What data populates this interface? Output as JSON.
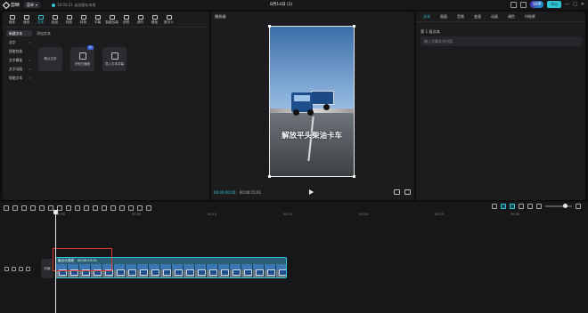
{
  "titlebar": {
    "app_name": "剪映",
    "menu_label": "菜单",
    "save_status": "16:03:21 自动保存本地",
    "project_title": "8月14日 (2)",
    "svip_label": "SVIP",
    "export_label": "导出",
    "window_controls": [
      "—",
      "□",
      "✕"
    ]
  },
  "toolbar": {
    "tools": [
      {
        "label": "媒体",
        "icon": "media-icon"
      },
      {
        "label": "音频",
        "icon": "audio-icon"
      },
      {
        "label": "文本",
        "icon": "text-icon",
        "active": true
      },
      {
        "label": "贴纸",
        "icon": "sticker-icon"
      },
      {
        "label": "特效",
        "icon": "effects-icon"
      },
      {
        "label": "转场",
        "icon": "transition-icon"
      },
      {
        "label": "字幕",
        "icon": "subtitle-icon"
      },
      {
        "label": "智能包装",
        "icon": "packaging-icon"
      },
      {
        "label": "滤镜",
        "icon": "filter-icon"
      },
      {
        "label": "调节",
        "icon": "adjust-icon"
      },
      {
        "label": "模板",
        "icon": "template-icon"
      },
      {
        "label": "数字人",
        "icon": "avatar-icon"
      }
    ]
  },
  "media_panel": {
    "categories": [
      {
        "label": "新建文本",
        "active": true
      },
      {
        "label": "花字",
        "arrow": "›"
      },
      {
        "label": "智能包装"
      },
      {
        "label": "文字模板",
        "arrow": "›"
      },
      {
        "label": "文字动画",
        "arrow": "›"
      },
      {
        "label": "智能文本",
        "arrow": "›"
      }
    ],
    "section_title": "添加文本",
    "cards": [
      {
        "label": "默认文本"
      },
      {
        "label": "识别已播放",
        "badge": "AI"
      },
      {
        "label": "导入文本字幕"
      }
    ]
  },
  "player": {
    "header": "播放器",
    "caption": "解放平头柴油卡车",
    "current_time": "00:00:00:00",
    "total_time": "00:00:15:01",
    "accent_color": "#2ec4d6"
  },
  "properties": {
    "tabs": [
      {
        "label": "文本",
        "active": true
      },
      {
        "label": "画面"
      },
      {
        "label": "音频"
      },
      {
        "label": "变速"
      },
      {
        "label": "动画"
      },
      {
        "label": "调色"
      },
      {
        "label": "AI效果"
      }
    ],
    "field_label": "第 1 段文本",
    "field_placeholder": "输入字幕文字内容"
  },
  "timeline": {
    "ruler_ticks": [
      "00:00",
      "00:05",
      "00:10",
      "00:15",
      "00:20",
      "00:25",
      "00:30",
      "00:35",
      "00:40"
    ],
    "cover_label": "封面",
    "clip": {
      "name": "聚合大视频",
      "duration": "00:00:15:01"
    },
    "thumb_count": 20
  }
}
